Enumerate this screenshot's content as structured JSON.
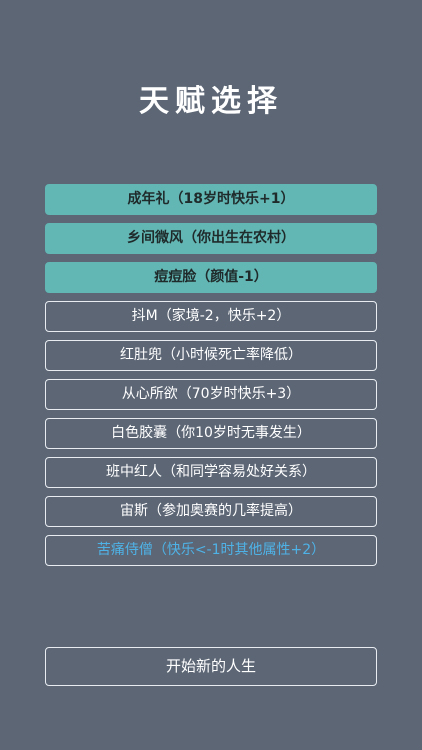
{
  "screen": {
    "title": "天赋选择"
  },
  "talents": [
    {
      "label": "成年礼（18岁时快乐+1）",
      "selected": true
    },
    {
      "label": "乡间微风（你出生在农村）",
      "selected": true
    },
    {
      "label": "痘痘脸（颜值-1）",
      "selected": true
    },
    {
      "label": "抖M（家境-2，快乐+2）",
      "selected": false
    },
    {
      "label": "红肚兜（小时候死亡率降低）",
      "selected": false
    },
    {
      "label": "从心所欲（70岁时快乐+3）",
      "selected": false
    },
    {
      "label": "白色胶囊（你10岁时无事发生）",
      "selected": false
    },
    {
      "label": "班中红人（和同学容易处好关系）",
      "selected": false
    },
    {
      "label": "宙斯（参加奥赛的几率提高）",
      "selected": false
    },
    {
      "label": "苦痛侍僧（快乐<-1时其他属性+2）",
      "selected": false,
      "rarity": "blue"
    }
  ],
  "actions": {
    "start_label": "开始新的人生"
  },
  "colors": {
    "background": "#5c6675",
    "selected": "#62b6b4",
    "rare_text": "#4fb2e6",
    "border": "#e9edf2"
  }
}
